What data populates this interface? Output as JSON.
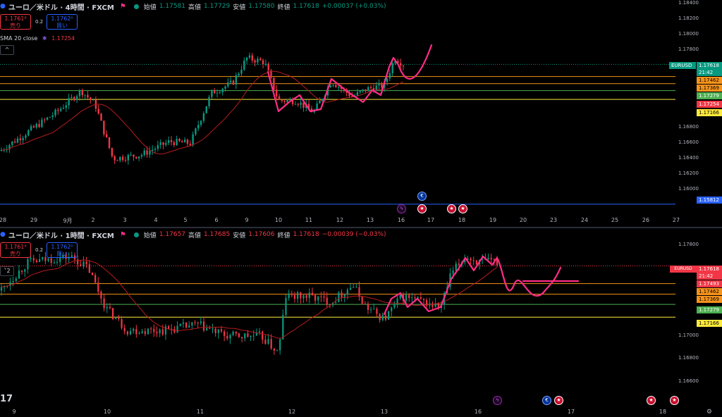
{
  "colors": {
    "up": "#089981",
    "down": "#f23645",
    "sma": "#b71c1c",
    "drawing": "#ff2d87",
    "orange": "#f7931a",
    "green": "#4caf50",
    "yellow": "#ffeb3b",
    "blue": "#2962ff",
    "dotted": "#f23645"
  },
  "pane1": {
    "title": "ユーロ／米ドル · 4時間 · FXCM",
    "open_label": "始値",
    "open": "1.17581",
    "high_label": "高値",
    "high": "1.17729",
    "low_label": "安値",
    "low": "1.17580",
    "close_label": "終値",
    "close": "1.17618",
    "change": "+0.00037 (+0.03%)",
    "sell_price": "1.1761⁸",
    "sell_label": "売り",
    "spread": "0.2",
    "buy_price": "1.1762⁰",
    "buy_label": "買い",
    "sma_label": "SMA 20 close",
    "sma_value": "1.17254",
    "symbol_tag": "EURUSD",
    "last_price": "1.17618",
    "countdown": "21:42",
    "price_tags": [
      {
        "text": "1.17462",
        "bg": "#f7931a",
        "fg": "#000"
      },
      {
        "text": "1.17369",
        "bg": "#f7931a",
        "fg": "#000"
      },
      {
        "text": "1.17279",
        "bg": "#4caf50",
        "fg": "#fff"
      },
      {
        "text": "1.17254",
        "bg": "#f23645",
        "fg": "#fff"
      },
      {
        "text": "1.17166",
        "bg": "#ffeb3b",
        "fg": "#000"
      },
      {
        "text": "1.15812",
        "bg": "#2962ff",
        "fg": "#fff"
      }
    ],
    "yticks": [
      "1.18400",
      "1.18200",
      "1.18000",
      "1.17800",
      "1.16800",
      "1.16600",
      "1.16400",
      "1.16200",
      "1.16000"
    ],
    "xticks": [
      "28",
      "29",
      "9月",
      "2",
      "3",
      "4",
      "5",
      "6",
      "9",
      "10",
      "11",
      "12",
      "13",
      "16",
      "17",
      "18",
      "19",
      "20",
      "23",
      "24",
      "25",
      "26",
      "27"
    ]
  },
  "pane2": {
    "title": "ユーロ／米ドル · 1時間 · FXCM",
    "open_label": "始値",
    "open": "1.17657",
    "high_label": "高値",
    "high": "1.17685",
    "low_label": "安値",
    "low": "1.17606",
    "close_label": "終値",
    "close": "1.17618",
    "change": "−0.00039 (−0.03%)",
    "sell_price": "1.1761⁸",
    "sell_label": "売り",
    "spread": "0.2",
    "buy_price": "1.1762⁰",
    "buy_label": "買い",
    "collapse_label": "2",
    "symbol_tag": "EURUSD",
    "last_price": "1.17618",
    "countdown": "21:42",
    "price_tags": [
      {
        "text": "1.17493",
        "bg": "#f23645",
        "fg": "#fff"
      },
      {
        "text": "1.17462",
        "bg": "#f7931a",
        "fg": "#000"
      },
      {
        "text": "1.17369",
        "bg": "#f7931a",
        "fg": "#000"
      },
      {
        "text": "1.17279",
        "bg": "#4caf50",
        "fg": "#fff"
      },
      {
        "text": "1.17166",
        "bg": "#ffeb3b",
        "fg": "#000"
      }
    ],
    "yticks": [
      "1.17800",
      "1.17000",
      "1.16800",
      "1.16600"
    ],
    "xticks": [
      "9",
      "10",
      "11",
      "12",
      "13",
      "16",
      "17",
      "18"
    ]
  },
  "chart_data": [
    {
      "type": "candlestick",
      "title": "ユーロ／米ドル · 4時間 · FXCM",
      "ylim": [
        1.1572,
        1.1845
      ],
      "x": [
        "28",
        "29",
        "9月",
        "2",
        "3",
        "4",
        "5",
        "6",
        "9",
        "10",
        "11",
        "12",
        "13",
        "16"
      ],
      "horizontal_levels": [
        1.17462,
        1.17369,
        1.17279,
        1.17166,
        1.15812
      ],
      "last": 1.17618,
      "sma20_last": 1.17254
    },
    {
      "type": "candlestick",
      "title": "ユーロ／米ドル · 1時間 · FXCM",
      "ylim": [
        1.1651,
        1.1795
      ],
      "x": [
        "9",
        "10",
        "11",
        "12",
        "13",
        "16"
      ],
      "horizontal_levels": [
        1.17462,
        1.17369,
        1.17279,
        1.17166
      ],
      "last": 1.17618
    }
  ]
}
